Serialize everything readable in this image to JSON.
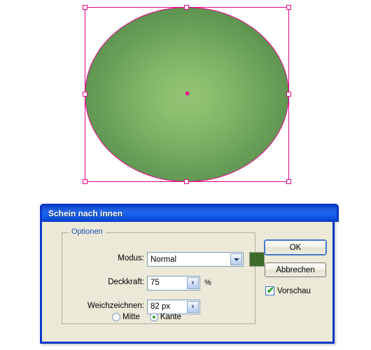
{
  "canvas": {
    "shape": {
      "name": "ellipse-with-inner-glow",
      "fill_center_color": "#93C476",
      "fill_edge_color": "#558C4B",
      "selection_color": "#EC008C"
    },
    "selection": {
      "handle_count": 8,
      "center_point_color": "#EC008C"
    }
  },
  "dialog": {
    "title": "Schein nach innen",
    "titlebar_color": "#1D63EE",
    "background_color": "#ECE9D8",
    "border_color": "#0A38C8",
    "group": {
      "legend": "Optionen",
      "legend_color": "#1B4FAE",
      "fields": {
        "modus": {
          "label": "Modus:",
          "value": "Normal",
          "options": [
            "Normal"
          ],
          "arrow_icon": "chevron-down-icon",
          "swatch_color": "#3D6B2C"
        },
        "deckkraft": {
          "label": "Deckkraft:",
          "value": "75",
          "unit": "%",
          "stepper_icon": "chevron-right-icon"
        },
        "weichzeichnen": {
          "label": "Weichzeichnen:",
          "value": "82 px",
          "stepper_icon": "chevron-right-icon"
        }
      },
      "radios": [
        {
          "label": "Mitte",
          "checked": false
        },
        {
          "label": "Kante",
          "checked": true
        }
      ],
      "radio_dot_color": "#2E9E2E"
    },
    "buttons": {
      "ok": "OK",
      "cancel": "Abbrechen"
    },
    "preview": {
      "label": "Vorschau",
      "checked": true,
      "check_glyph": "✔",
      "check_color": "#1FA01F"
    }
  }
}
